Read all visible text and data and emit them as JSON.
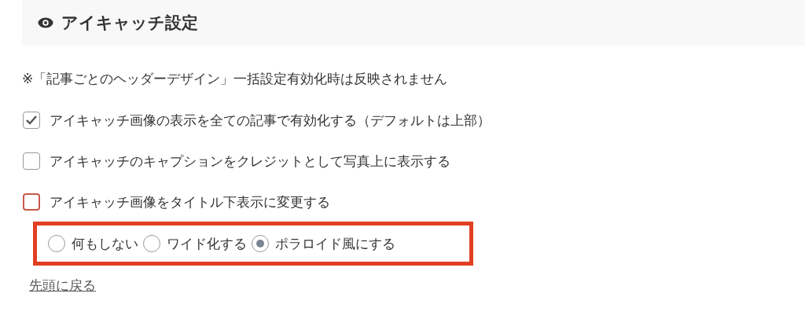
{
  "section": {
    "title": "アイキャッチ設定"
  },
  "note": "※「記事ごとのヘッダーデザイン」一括設定有効化時は反映されません",
  "options": [
    {
      "label": "アイキャッチ画像の表示を全ての記事で有効化する（デフォルトは上部）",
      "checked": true,
      "highlighted": false
    },
    {
      "label": "アイキャッチのキャプションをクレジットとして写真上に表示する",
      "checked": false,
      "highlighted": false
    },
    {
      "label": "アイキャッチ画像をタイトル下表示に変更する",
      "checked": false,
      "highlighted": true
    }
  ],
  "radio_group": {
    "highlighted": true,
    "items": [
      {
        "label": "何もしない",
        "selected": false
      },
      {
        "label": "ワイド化する",
        "selected": false
      },
      {
        "label": "ポラロイド風にする",
        "selected": true
      }
    ]
  },
  "back_link": "先頭に戻る"
}
